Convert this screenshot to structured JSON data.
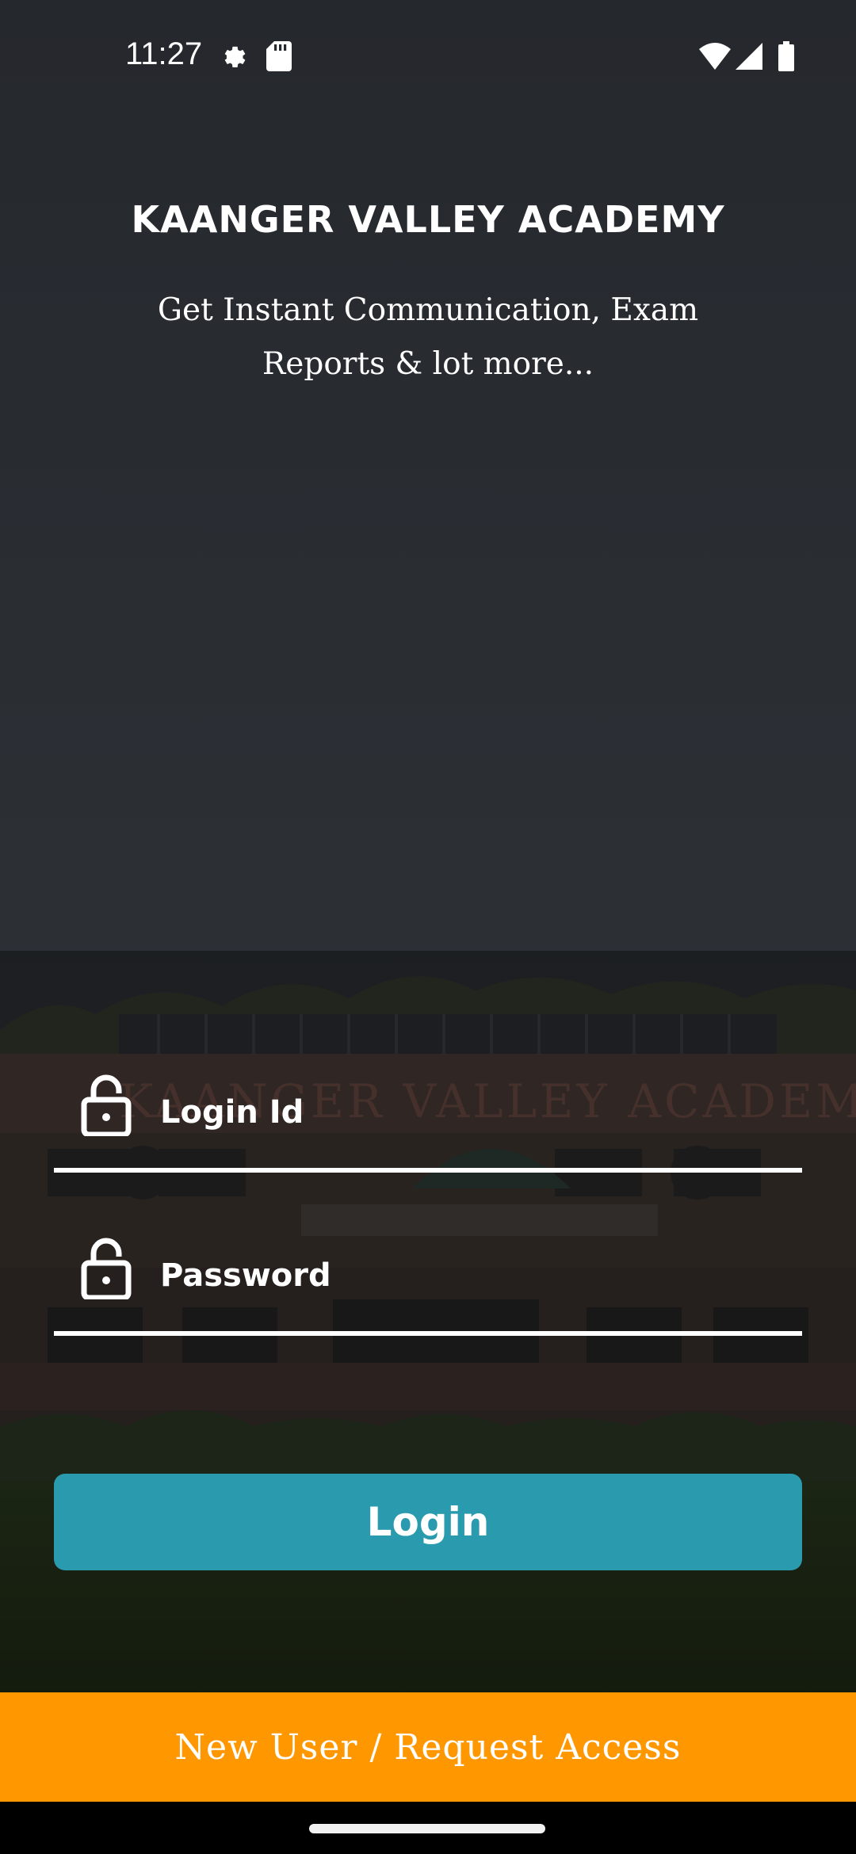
{
  "status_bar": {
    "time": "11:27",
    "icons": [
      "settings-icon",
      "sd-card-icon",
      "wifi-icon",
      "cell-signal-icon",
      "battery-icon"
    ]
  },
  "header": {
    "title": "KAANGER VALLEY ACADEMY",
    "tagline": "Get Instant Communication, Exam Reports & lot more..."
  },
  "form": {
    "login_id_placeholder": "Login Id",
    "password_placeholder": "Password",
    "field_icon": "padlock-open-icon"
  },
  "login_button": {
    "label": "Login",
    "color": "#2a9aae"
  },
  "request_banner": {
    "label": "New User / Request Access",
    "color": "#ff9800"
  },
  "background_photo": {
    "sign_text": "KAANGER VALLEY ACADEMY"
  }
}
